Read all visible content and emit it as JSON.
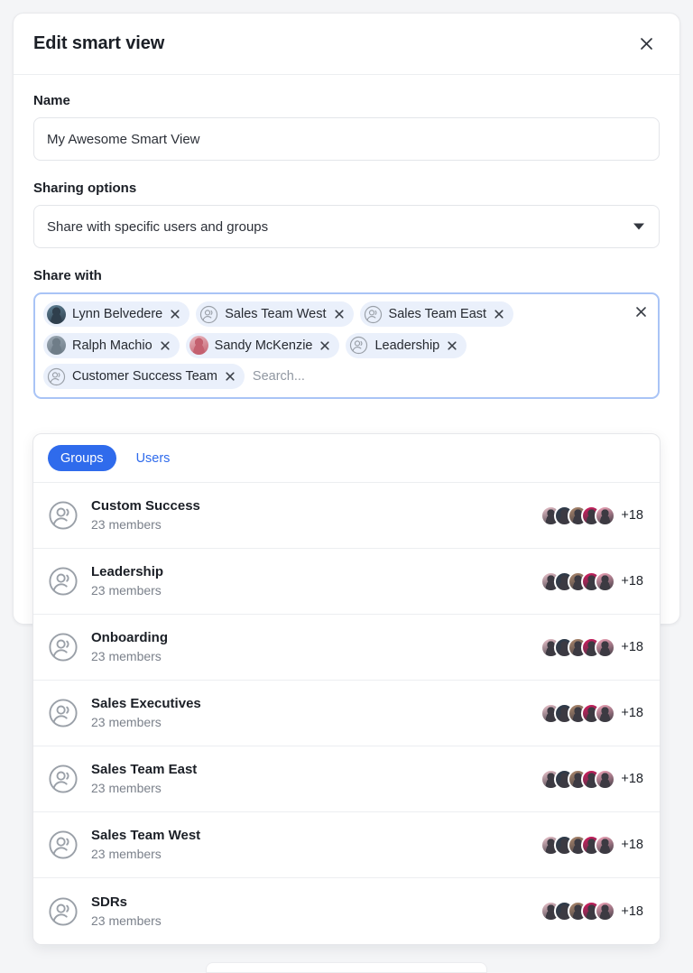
{
  "dialog": {
    "title": "Edit smart view",
    "close_icon": "close-icon"
  },
  "name_field": {
    "label": "Name",
    "value": "My Awesome Smart View"
  },
  "sharing_options": {
    "label": "Sharing options",
    "selected": "Share with specific users and groups",
    "caret_icon": "chevron-down-icon"
  },
  "share_with": {
    "label": "Share with",
    "search_placeholder": "Search...",
    "clear_all_icon": "close-icon",
    "chips": [
      {
        "label": "Lynn Belvedere",
        "type": "user",
        "avatar_colors": [
          "#5d7f93",
          "#2f3f4d"
        ],
        "remove_icon": "close-icon"
      },
      {
        "label": "Sales Team West",
        "type": "group",
        "remove_icon": "close-icon"
      },
      {
        "label": "Sales Team East",
        "type": "group",
        "remove_icon": "close-icon"
      },
      {
        "label": "Ralph Machio",
        "type": "user",
        "avatar_colors": [
          "#9aa7b2",
          "#6f7d88"
        ],
        "remove_icon": "close-icon"
      },
      {
        "label": "Sandy McKenzie",
        "type": "user",
        "avatar_colors": [
          "#e8b8c0",
          "#c4606f"
        ],
        "remove_icon": "close-icon"
      },
      {
        "label": "Leadership",
        "type": "group",
        "remove_icon": "close-icon"
      },
      {
        "label": "Customer Success Team",
        "type": "group",
        "remove_icon": "close-icon"
      }
    ]
  },
  "dropdown": {
    "tabs": [
      {
        "label": "Groups",
        "active": true
      },
      {
        "label": "Users",
        "active": false
      }
    ],
    "rows": [
      {
        "name": "Custom Success",
        "members": "23 members",
        "overflow": "+18"
      },
      {
        "name": "Leadership",
        "members": "23 members",
        "overflow": "+18"
      },
      {
        "name": "Onboarding",
        "members": "23 members",
        "overflow": "+18"
      },
      {
        "name": "Sales Executives",
        "members": "23 members",
        "overflow": "+18"
      },
      {
        "name": "Sales Team East",
        "members": "23 members",
        "overflow": "+18"
      },
      {
        "name": "Sales Team West",
        "members": "23 members",
        "overflow": "+18"
      },
      {
        "name": "SDRs",
        "members": "23 members",
        "overflow": "+18"
      }
    ],
    "stack_avatar_colors": [
      "#f0c6cf",
      "#2c3a4a",
      "#b08a6e",
      "#d81b60",
      "#f7a8bd"
    ],
    "row_icon": "group-icon"
  },
  "colors": {
    "accent": "#2f6bec",
    "focus_border": "#a9c4f6",
    "chip_bg": "#eaf0fb",
    "page_bg": "#f4f5f7"
  }
}
